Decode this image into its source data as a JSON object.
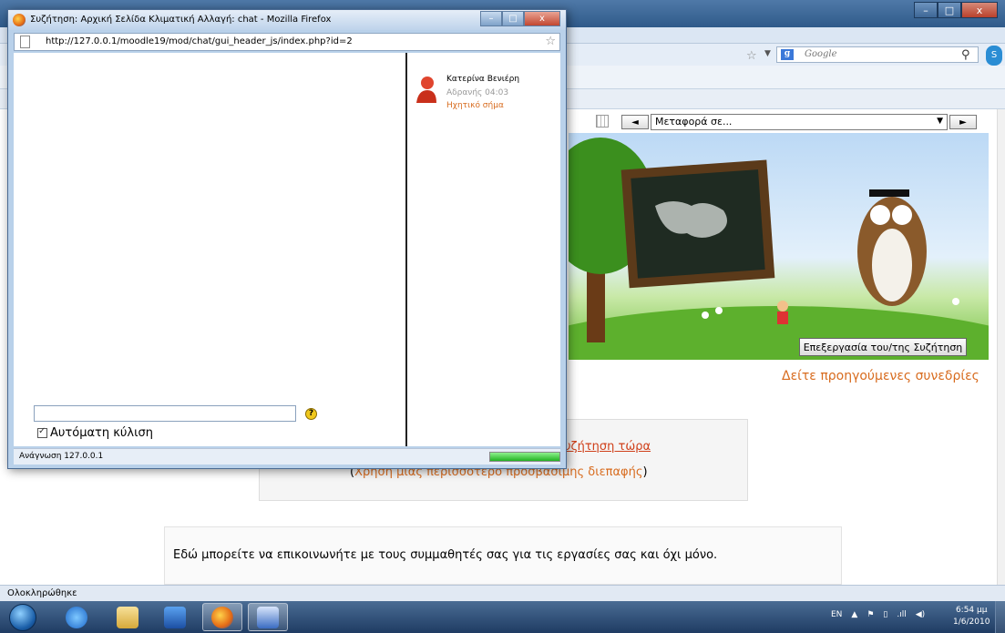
{
  "background_page": {
    "window_controls": [
      "–",
      "□",
      "x"
    ],
    "search_placeholder": "Google",
    "nav": {
      "prev": "◄",
      "jump_select": "Μεταφορά σε...",
      "next": "►"
    },
    "edit_chat_button": "Επεξεργασία του/της Συζήτηση",
    "prev_sessions_link": "Δείτε προηγούμενες συνεδρίες",
    "chat_now_link": "υζήτηση τώρα",
    "access_prefix": "(",
    "access_link": "Χρήση μιας περισσότερο προσβάσιμης διεπαφής",
    "access_suffix": ")",
    "intro_text": "Εδώ μπορείτε να επικοινωνήτε με τους συμμαθητές σας για τις εργασίες σας και όχι μόνο.",
    "status": "Ολοκληρώθηκε"
  },
  "popup": {
    "title": "Συζήτηση: Αρχική Σελίδα Κλιματική Αλλαγή: chat - Mozilla Firefox",
    "window_controls": [
      "–",
      "□",
      "x"
    ],
    "url": "http://127.0.0.1/moodle19/mod/chat/gui_header_js/index.php?id=2",
    "users": [
      {
        "name": "Κατερίνα Βενιέρη",
        "idle": "Αδρανής 04:03",
        "beep": "Ηχητικό σήμα"
      }
    ],
    "message_value": "",
    "help_icon": "?",
    "autoscroll_label": "Αυτόματη κύλιση",
    "autoscroll_checked": true,
    "status": "Ανάγνωση 127.0.0.1",
    "progress": 1.0
  },
  "taskbar": {
    "apps": [
      "start-orb",
      "ie-icon",
      "explorer-icon",
      "media-player-icon",
      "firefox-icon",
      "word-icon"
    ],
    "tray": [
      "EN",
      "▲",
      "⚑",
      "▯",
      ".ıll",
      "◀)"
    ],
    "time": "6:54 μμ",
    "date": "1/6/2010"
  },
  "colors": {
    "link_orange": "#d86c1f",
    "link_red": "#d0401a",
    "titlebar_blue": "#2f5a8a"
  }
}
